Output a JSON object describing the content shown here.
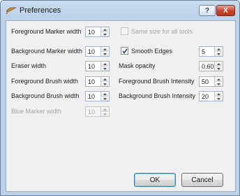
{
  "window": {
    "title": "Preferences",
    "help_label": "?",
    "close_label": "X"
  },
  "left_fields": [
    {
      "label": "Foreground Marker width",
      "value": "10",
      "enabled": true
    },
    {
      "label": "Background Marker width",
      "value": "10",
      "enabled": true
    },
    {
      "label": "Eraser width",
      "value": "10",
      "enabled": true
    },
    {
      "label": "Foreground Brush width",
      "value": "10",
      "enabled": true
    },
    {
      "label": "Background Brush width",
      "value": "10",
      "enabled": true
    },
    {
      "label": "Blue Marker width",
      "value": "10",
      "enabled": false
    }
  ],
  "same_size": {
    "label": "Same size for all tools",
    "checked": false,
    "enabled": false
  },
  "smooth_edges": {
    "label": "Smooth Edges",
    "checked": true,
    "value": "5"
  },
  "right_fields": [
    {
      "label": "Mask opacity",
      "value": "0.60"
    },
    {
      "label": "Foreground Brush Intensity",
      "value": "50"
    },
    {
      "label": "Background Brush Intensity",
      "value": "20"
    }
  ],
  "buttons": {
    "ok": "OK",
    "cancel": "Cancel"
  },
  "icons": {
    "app": "feather-app-icon",
    "spin_up": "arrow-up-icon",
    "spin_down": "arrow-down-icon",
    "check": "checkmark-icon"
  },
  "colors": {
    "title_bar": "#bcd1ea",
    "client_bg": "#f0f0f0",
    "close_button": "#c8432c",
    "default_button_border": "#3c7fb1"
  }
}
